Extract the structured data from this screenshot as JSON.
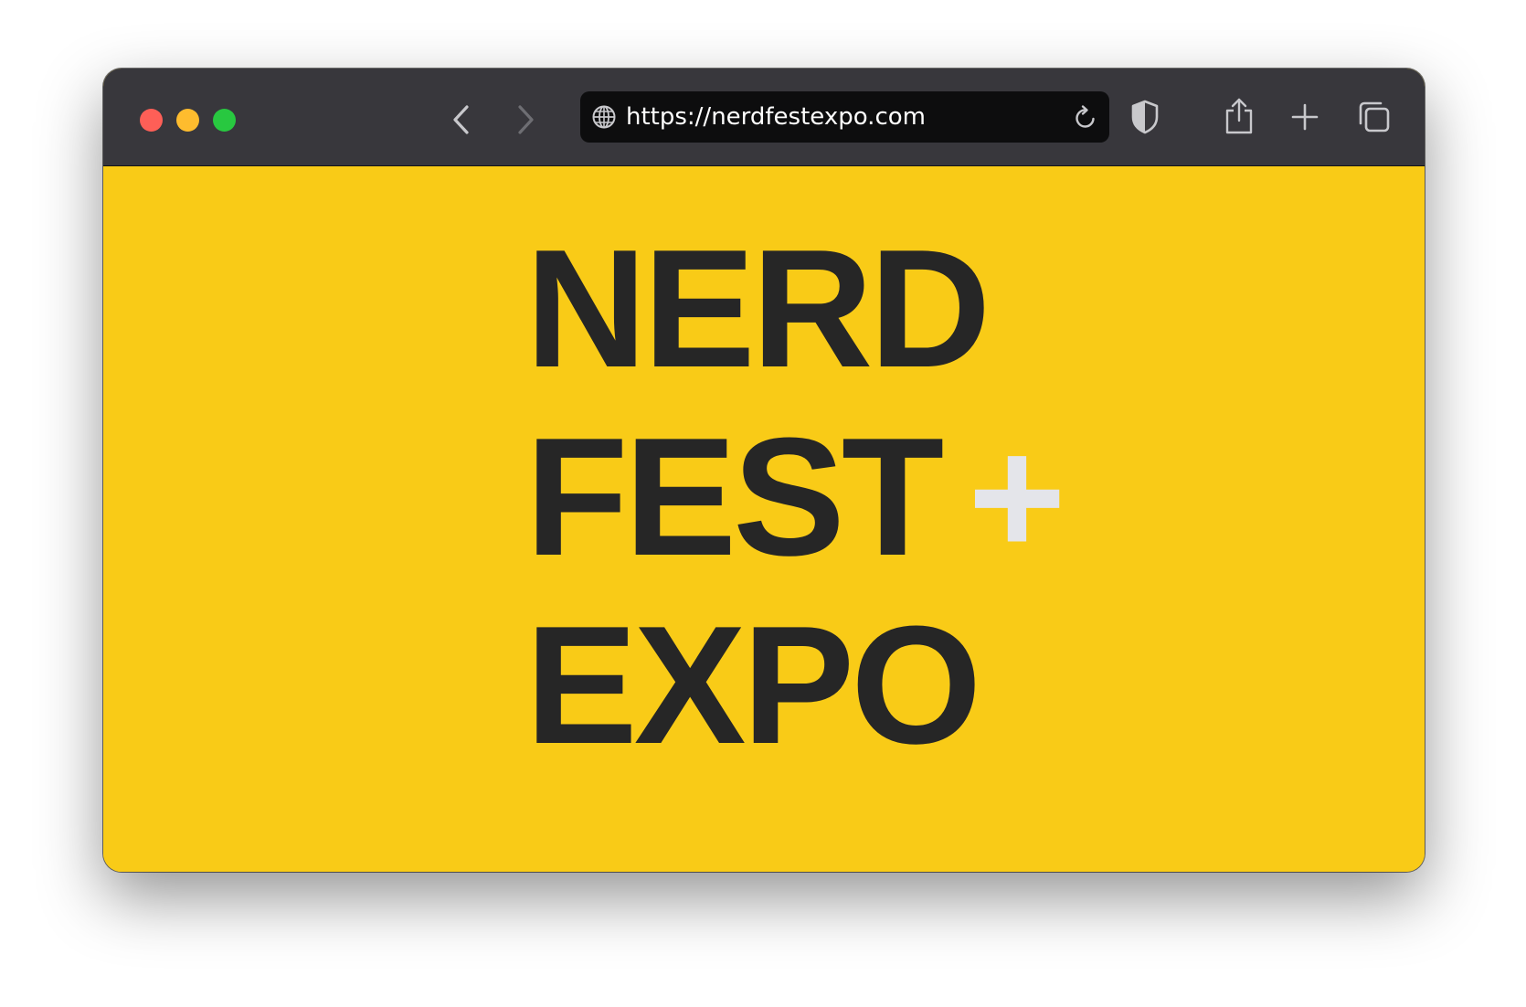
{
  "window": {
    "traffic_lights": {
      "close_color": "#fe5f57",
      "minimize_color": "#febc2e",
      "zoom_color": "#28c840"
    }
  },
  "toolbar": {
    "back_icon": "chevron-left-icon",
    "forward_icon": "chevron-right-icon",
    "privacy_icon": "shield-icon",
    "share_icon": "share-icon",
    "new_tab_icon": "plus-icon",
    "tab_overview_icon": "tabs-icon"
  },
  "address_bar": {
    "url": "https://nerdfestexpo.com",
    "site_icon": "globe-icon",
    "reload_icon": "reload-icon"
  },
  "page": {
    "background_color": "#f9cb17",
    "text_color": "#262626",
    "accent_color": "#e4e5ea",
    "title_lines": [
      "NERD",
      "FEST",
      "EXPO"
    ],
    "plus_mark": "+"
  }
}
